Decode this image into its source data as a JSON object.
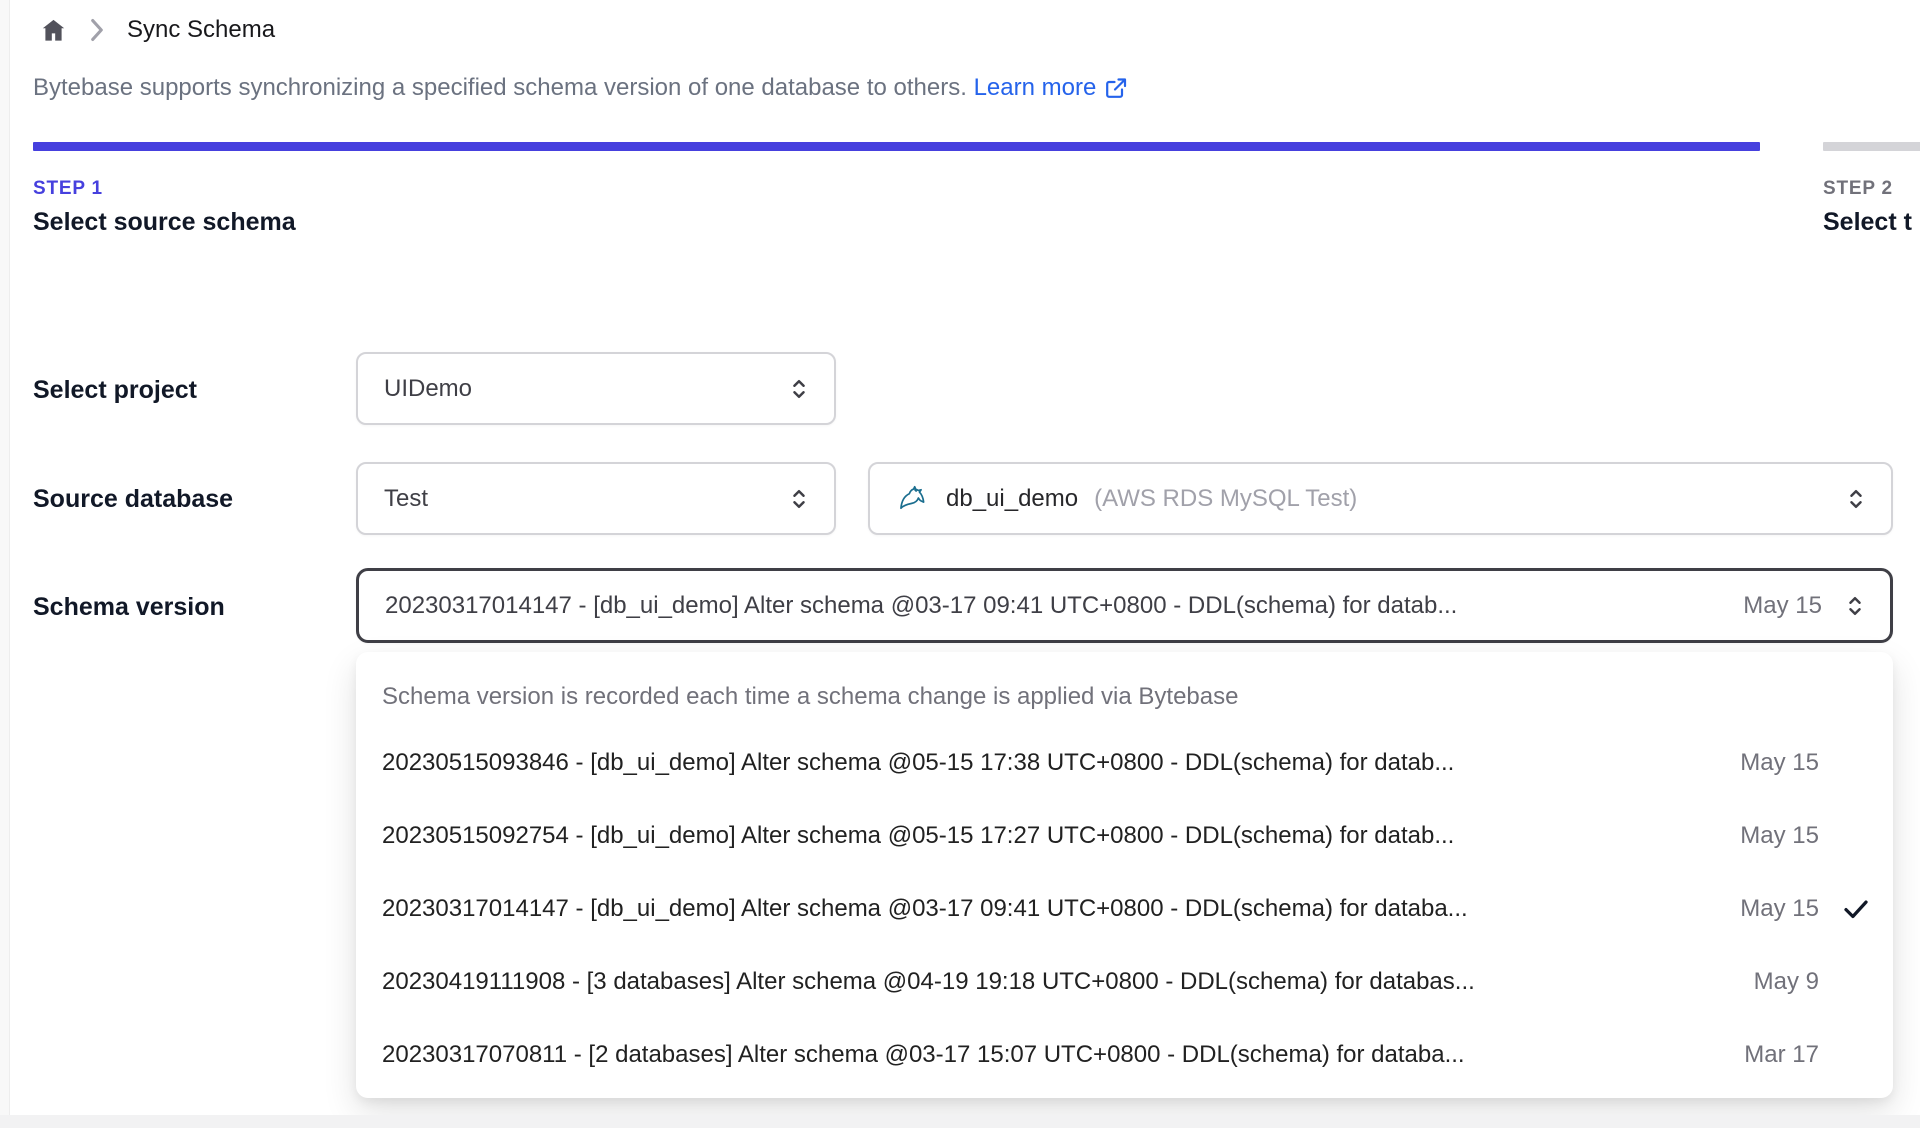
{
  "breadcrumb": {
    "home_icon": "home-icon",
    "current": "Sync Schema"
  },
  "intro": {
    "text": "Bytebase supports synchronizing a specified schema version of one database to others.",
    "link_label": "Learn more",
    "link_icon": "external-link-icon"
  },
  "steps": {
    "step1": {
      "eyebrow": "STEP 1",
      "title": "Select source schema"
    },
    "step2": {
      "eyebrow": "STEP 2",
      "title": "Select t"
    }
  },
  "form": {
    "project_label": "Select project",
    "project_value": "UIDemo",
    "source_db_label": "Source database",
    "environment_value": "Test",
    "database_value": "db_ui_demo",
    "database_detail": "(AWS RDS MySQL Test)",
    "engine_icon": "mysql-dolphin-icon",
    "schema_version_label": "Schema version",
    "schema_version_value": "20230317014147 - [db_ui_demo] Alter schema @03-17 09:41 UTC+0800 - DDL(schema) for datab...",
    "schema_version_date": "May 15",
    "selector_icon": "chevron-up-down-icon"
  },
  "dropdown": {
    "note": "Schema version is recorded each time a schema change is applied via Bytebase",
    "check_icon": "check-icon",
    "options": [
      {
        "text": "20230515093846 - [db_ui_demo] Alter schema @05-15 17:38 UTC+0800 - DDL(schema) for datab...",
        "date": "May 15",
        "selected": false
      },
      {
        "text": "20230515092754 - [db_ui_demo] Alter schema @05-15 17:27 UTC+0800 - DDL(schema) for datab...",
        "date": "May 15",
        "selected": false
      },
      {
        "text": "20230317014147 - [db_ui_demo] Alter schema @03-17 09:41 UTC+0800 - DDL(schema) for databa...",
        "date": "May 15",
        "selected": true
      },
      {
        "text": "20230419111908 - [3 databases] Alter schema @04-19 19:18 UTC+0800 - DDL(schema) for databas...",
        "date": "May 9",
        "selected": false
      },
      {
        "text": "20230317070811 - [2 databases] Alter schema @03-17 15:07 UTC+0800 - DDL(schema) for databa...",
        "date": "Mar 17",
        "selected": false
      }
    ]
  },
  "colors": {
    "accent": "#4640DE",
    "link": "#2563EB",
    "inactive_bar": "#D4D4D8"
  }
}
